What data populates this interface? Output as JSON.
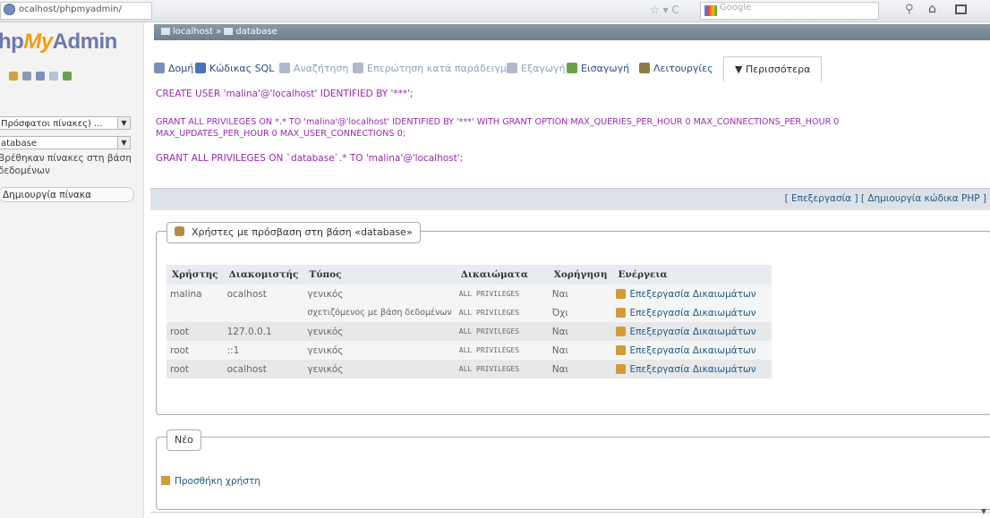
{
  "browser": {
    "url": "ocalhost/phpmyadmin/",
    "search_placeholder": "Google"
  },
  "sidebar": {
    "logo_php": "hp",
    "logo_my": "My",
    "logo_admin": "Admin",
    "recent_select": "Πρόσφατοι πίνακες) ...",
    "db_select": "atabase",
    "no_tables": "Βρέθηκαν πίνακες στη βάση δεδομένων",
    "new_table": "Δημιουργία πίνακα"
  },
  "breadcrumb": {
    "server": "localhost",
    "database": "database"
  },
  "tabs": [
    {
      "label": "Δομή",
      "icon_color": "#7a8fb8",
      "dim": false
    },
    {
      "label": "Κώδικας SQL",
      "icon_color": "#4a73b5",
      "dim": false
    },
    {
      "label": "Αναζήτηση",
      "icon_color": "#aeb9cc",
      "dim": true
    },
    {
      "label": "Επερώτηση κατά παράδειγμα",
      "icon_color": "#aeb9cc",
      "dim": true
    },
    {
      "label": "Εξαγωγή",
      "icon_color": "#aeb9cc",
      "dim": true
    },
    {
      "label": "Εισαγωγή",
      "icon_color": "#6aa14b",
      "dim": false
    },
    {
      "label": "Λειτουργίες",
      "icon_color": "#8c7a4a",
      "dim": false
    }
  ],
  "more_tab": "▼ Περισσότερα",
  "sql": {
    "line1": "CREATE USER 'malina'@'localhost' IDENTIFIED BY '***';",
    "line2a": "GRANT ALL PRIVILEGES ON *.* TO 'malina'@'localhost' IDENTIFIED BY '***' WITH GRANT OPTION MAX_QUERIES_PER_HOUR 0 MAX_CONNECTIONS_PER_HOUR 0",
    "line2b": "MAX_UPDATES_PER_HOUR 0 MAX_USER_CONNECTIONS 0;",
    "line3": "GRANT ALL PRIVILEGES ON `database`.* TO 'malina'@'localhost';"
  },
  "editbar": {
    "edit": "[ Επεξεργασία ]",
    "create_php": "[ Δημιουργία κώδικα PHP ]"
  },
  "users_section": {
    "legend": "Χρήστες με πρόσβαση στη βάση «database»",
    "headers": [
      "Χρήστης",
      "Διακομιστής",
      "Τύπος",
      "Δικαιώματα",
      "Χορήγηση",
      "Ενέργεια"
    ],
    "rows": [
      {
        "user": "malina",
        "host": "ocalhost",
        "type": "γενικός",
        "privs": "ALL PRIVILEGES",
        "grant": "Ναι",
        "action": "Επεξεργασία Δικαιωμάτων"
      },
      {
        "user": "",
        "host": "",
        "type": "σχετιζόμενος με βάση δεδομένων",
        "privs": "ALL PRIVILEGES",
        "grant": "Όχι",
        "action": "Επεξεργασία Δικαιωμάτων"
      },
      {
        "user": "root",
        "host": "127.0.0.1",
        "type": "γενικός",
        "privs": "ALL PRIVILEGES",
        "grant": "Ναι",
        "action": "Επεξεργασία Δικαιωμάτων"
      },
      {
        "user": "root",
        "host": "::1",
        "type": "γενικός",
        "privs": "ALL PRIVILEGES",
        "grant": "Ναι",
        "action": "Επεξεργασία Δικαιωμάτων"
      },
      {
        "user": "root",
        "host": "ocalhost",
        "type": "γενικός",
        "privs": "ALL PRIVILEGES",
        "grant": "Ναι",
        "action": "Επεξεργασία Δικαιωμάτων"
      }
    ]
  },
  "new_section": {
    "legend": "Νέο",
    "add_user": "Προσθήκη χρήστη"
  }
}
